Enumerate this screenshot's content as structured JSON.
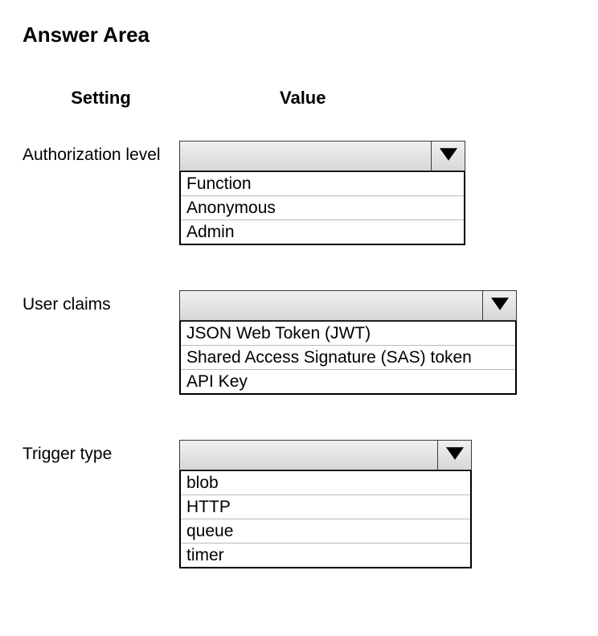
{
  "title": "Answer Area",
  "headers": {
    "setting": "Setting",
    "value": "Value"
  },
  "fields": {
    "auth": {
      "label": "Authorization level",
      "options": {
        "o0": "Function",
        "o1": "Anonymous",
        "o2": "Admin"
      }
    },
    "claims": {
      "label": "User claims",
      "options": {
        "o0": "JSON Web Token (JWT)",
        "o1": "Shared Access Signature (SAS) token",
        "o2": "API Key"
      }
    },
    "trigger": {
      "label": "Trigger type",
      "options": {
        "o0": "blob",
        "o1": "HTTP",
        "o2": "queue",
        "o3": "timer"
      }
    }
  }
}
